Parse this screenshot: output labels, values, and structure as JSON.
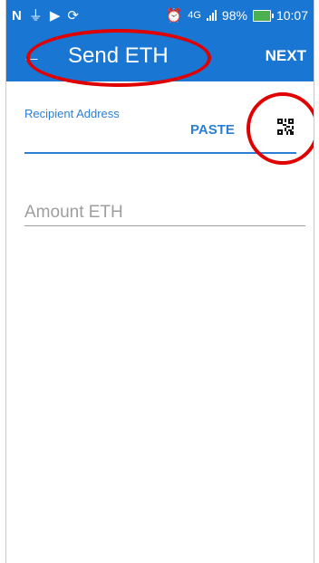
{
  "status_bar": {
    "network": "4G",
    "battery_percent": "98%",
    "time": "10:07",
    "left_icons": [
      "notification-n-icon",
      "usb-icon",
      "cast-icon",
      "sync-icon"
    ],
    "right_icons": [
      "alarm-icon",
      "signal-icon",
      "battery-icon"
    ]
  },
  "app_bar": {
    "back_icon": "arrow-left-icon",
    "title": "Send ETH",
    "next_label": "NEXT",
    "background_color": "#1976d2"
  },
  "form": {
    "recipient_label": "Recipient Address",
    "recipient_value": "",
    "paste_label": "PASTE",
    "qr_icon": "qr-code-icon",
    "amount_placeholder": "Amount ETH",
    "accent_color": "#2b7fd4"
  },
  "annotations": {
    "color": "#e00000",
    "shapes": [
      "ellipse-around-title",
      "circle-around-qr-icon"
    ]
  }
}
